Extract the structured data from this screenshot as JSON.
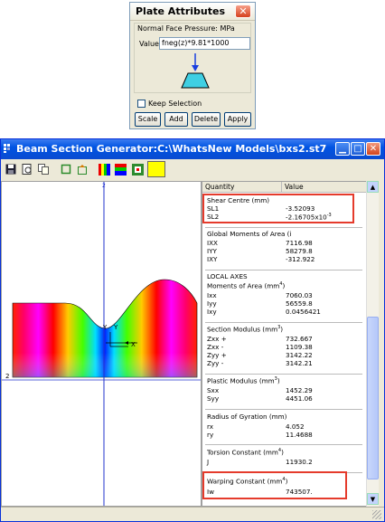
{
  "plate_attributes": {
    "title": "Plate Attributes",
    "group_label": "Normal Face Pressure: MPa",
    "value_label": "Value",
    "value_input": "fneg(z)*9.81*1000",
    "keep_selection_label": "Keep Selection",
    "keep_selection_checked": false,
    "buttons": [
      "Scale",
      "Add",
      "Delete",
      "Apply"
    ]
  },
  "beam_window": {
    "title": "Beam Section Generator:C:\\WhatsNew Models\\bxs2.st7",
    "toolbar_icons": [
      "save-icon",
      "print-preview-icon",
      "copy-icon",
      "rectangle-icon",
      "export-icon",
      "contour-icon",
      "bands-icon",
      "section-icon",
      "color-icon"
    ],
    "plot_axis_labels": {
      "y1": "Y",
      "y2": "Y",
      "x": "X",
      "label_2": "2"
    },
    "property_headers": {
      "quantity": "Quantity",
      "value": "Value"
    },
    "sections": [
      {
        "title": "Shear Centre (mm)",
        "rows": [
          [
            "SL1",
            "-3.52093"
          ],
          [
            "SL2",
            "-2.16705x10"
          ]
        ],
        "sl2_exponent": "-3"
      },
      {
        "title": "Global Moments of Area (i",
        "rows": [
          [
            "IXX",
            "7116.98"
          ],
          [
            "IYY",
            "58279.8"
          ],
          [
            "IXY",
            "-312.922"
          ]
        ]
      },
      {
        "title": "LOCAL AXES",
        "subtitle": "Moments of Area (mm",
        "subtitle_sup": "4",
        "rows": [
          [
            "Ixx",
            "7060.03"
          ],
          [
            "Iyy",
            "56559.8"
          ],
          [
            "Ixy",
            "0.0456421"
          ]
        ]
      },
      {
        "title": "Section Modulus (mm",
        "title_sup": "3",
        "rows": [
          [
            "Zxx +",
            "732.667"
          ],
          [
            "Zxx -",
            "1109.38"
          ],
          [
            "Zyy +",
            "3142.22"
          ],
          [
            "Zyy -",
            "3142.21"
          ]
        ]
      },
      {
        "title": "Plastic Modulus (mm",
        "title_sup": "3",
        "rows": [
          [
            "Sxx",
            "1452.29"
          ],
          [
            "Syy",
            "4451.06"
          ]
        ]
      },
      {
        "title": "Radius of Gyration (mm)",
        "rows": [
          [
            "rx",
            "4.052"
          ],
          [
            "ry",
            "11.4688"
          ]
        ]
      },
      {
        "title": "Torsion Constant (mm",
        "title_sup": "4",
        "rows": [
          [
            "J",
            "11930.2"
          ]
        ]
      },
      {
        "title": "Warping Constant (mm",
        "title_sup": "4",
        "rows": [
          [
            "Iw",
            "743507."
          ]
        ]
      }
    ],
    "highlight_color": "#e53b2c"
  }
}
